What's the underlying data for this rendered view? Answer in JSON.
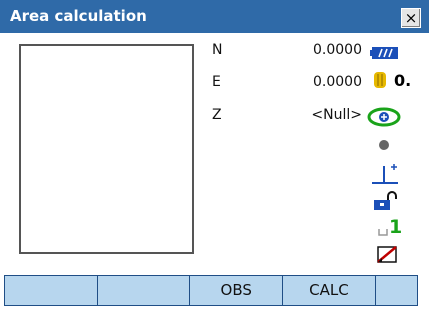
{
  "window": {
    "title": "Area calculation",
    "close_symbol": "×"
  },
  "fields": [
    {
      "label": "N",
      "value": "0.0000"
    },
    {
      "label": "E",
      "value": "0.0000"
    },
    {
      "label": "Z",
      "value": "<Null>"
    }
  ],
  "status_icons": {
    "battery": "battery-icon",
    "prism_constant": "0.",
    "target": "target-icon",
    "circle": "circle-icon",
    "tilt": "tilt-icon",
    "lock": "lock-icon",
    "page_indicator": "1",
    "edit": "edit-icon"
  },
  "softkeys": [
    "",
    "",
    "OBS",
    "CALC",
    ""
  ]
}
